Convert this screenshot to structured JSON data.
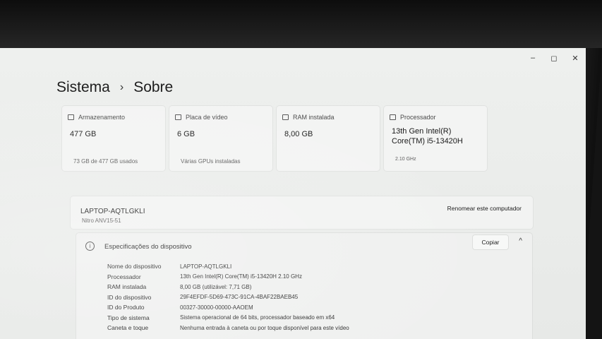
{
  "window": {
    "minimize_icon": "minimize-icon",
    "maximize_icon": "maximize-icon",
    "close_icon": "close-icon",
    "minimize_glyph": "–",
    "maximize_glyph": "◻",
    "close_glyph": "✕"
  },
  "breadcrumb": {
    "parent": "Sistema",
    "separator": "›",
    "current": "Sobre"
  },
  "cards": [
    {
      "icon": "storage-icon",
      "label": "Armazenamento",
      "value": "477 GB",
      "sub": "73 GB de 477 GB usados"
    },
    {
      "icon": "display-adapter-icon",
      "label": "Placa de vídeo",
      "value": "6 GB",
      "sub": "Várias GPUs instaladas"
    },
    {
      "icon": "ram-icon",
      "label": "RAM instalada",
      "value": "8,00 GB",
      "sub": ""
    },
    {
      "icon": "processor-icon",
      "label": "Processador",
      "value_line1": "13th Gen Intel(R)",
      "value_line2": "Core(TM) i5-13420H",
      "sub": "2.10 GHz"
    }
  ],
  "device": {
    "name": "LAPTOP-AQTLGKLI",
    "model": "Nitro ANV15-51",
    "rename_label": "Renomear este computador"
  },
  "specs": {
    "info_glyph": "i",
    "title": "Especificações do dispositivo",
    "copy_label": "Copiar",
    "chevron": "^",
    "rows": [
      {
        "label": "Nome do dispositivo",
        "value": "LAPTOP-AQTLGKLI"
      },
      {
        "label": "Processador",
        "value": "13th Gen Intel(R) Core(TM) i5-13420H   2.10 GHz"
      },
      {
        "label": "RAM instalada",
        "value": "8,00 GB (utilizável: 7,71 GB)"
      },
      {
        "label": "ID do dispositivo",
        "value": "29F4EFDF-5D69-473C-91CA-4BAF22BAEB45"
      },
      {
        "label": "ID do Produto",
        "value": "00327-30000-00000-AAOEM"
      },
      {
        "label": "Tipo de sistema",
        "value": "Sistema operacional de 64 bits, processador baseado em x64"
      },
      {
        "label": "Caneta e toque",
        "value": "Nenhuma entrada à caneta ou por toque disponível para este vídeo"
      }
    ]
  }
}
